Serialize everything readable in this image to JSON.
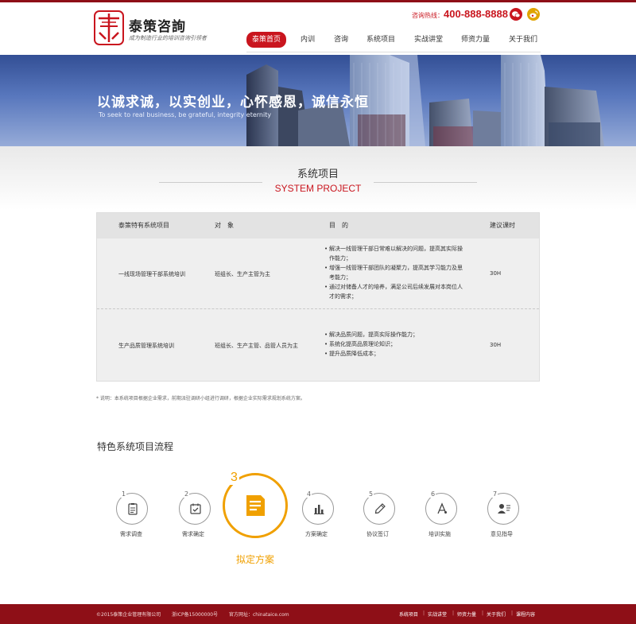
{
  "header": {
    "brand": "泰策咨詢",
    "slogan": "成为制造行业的培训咨询引领者",
    "hotline_label": "咨询热线：",
    "hotline_number": "400-888-8888",
    "nav": [
      "泰策首页",
      "内训",
      "咨询",
      "系统项目",
      "实战讲堂",
      "师资力量",
      "关于我们"
    ],
    "active_nav": "泰策首页"
  },
  "banner": {
    "headline": "以诚求诚，以实创业，心怀感恩，诚信永恒",
    "subline": "To seek to real business, be grateful, integrity eternity"
  },
  "section": {
    "title_cn": "系统项目",
    "title_en": "SYSTEM PROJECT"
  },
  "table": {
    "headers": [
      "泰策特有系统项目",
      "对　象",
      "目　的",
      "建议课时"
    ],
    "rows": [
      {
        "project": "一线现场管理干部系统培训",
        "target": "班组长、生产主管为主",
        "goals": [
          "解决一线管理干部日常难以解决的问题，提高其实际操作能力；",
          "增强一线管理干部团队的凝聚力，提高其学习能力及思考能力；",
          "通过对储备人才的培养，满足公司后续发展对本岗位人才的需求；"
        ],
        "hours": "30H"
      },
      {
        "project": "生产品质管理系统培训",
        "target": "班组长、生产主管、品管人员为主",
        "goals": [
          "解决品质问题，提高实际操作能力；",
          "系统化提高品质理论知识；",
          "提升品质降低成本；"
        ],
        "hours": "30H"
      }
    ],
    "note": "* 说明：本系统项目根据企业需求，前期派驻调研小组进行调研，根据企业实际需求规划系统方案。"
  },
  "process": {
    "title": "特色系统项目流程",
    "steps": [
      {
        "num": "1",
        "label": "需求调查"
      },
      {
        "num": "2",
        "label": "需求确定"
      },
      {
        "num": "3",
        "label": "拟定方案"
      },
      {
        "num": "4",
        "label": "方案确定"
      },
      {
        "num": "5",
        "label": "协议签订"
      },
      {
        "num": "6",
        "label": "培训实施"
      },
      {
        "num": "7",
        "label": "意见指导"
      }
    ],
    "active_step": "3"
  },
  "footer": {
    "copyright": "©2015泰策企业管理有限公司",
    "icp": "浙ICP备15000000号",
    "site": "官方网址：chinataice.com",
    "links": [
      "系统项目",
      "实战讲堂",
      "师资力量",
      "关于我们",
      "课程内容"
    ]
  },
  "colors": {
    "brand_red": "#c9151e",
    "footer_red": "#8e0f17",
    "accent_orange": "#f0a000"
  }
}
